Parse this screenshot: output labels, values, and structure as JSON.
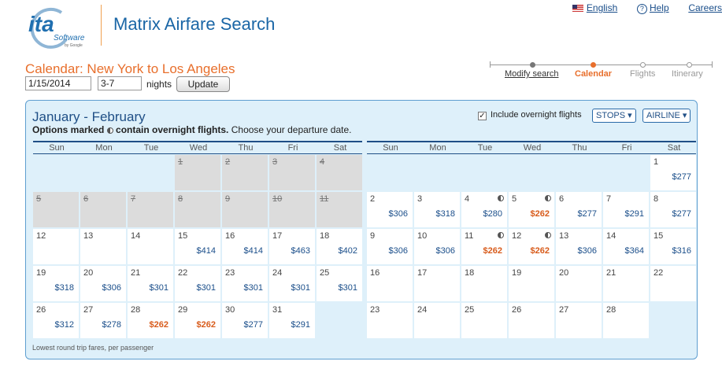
{
  "header": {
    "logo_text": "ita",
    "logo_sub": "Software",
    "logo_by": "by Google",
    "app_title": "Matrix Airfare Search",
    "links": [
      "English",
      "Help",
      "Careers"
    ]
  },
  "page_title": "Calendar: New York to Los Angeles",
  "form": {
    "date": "1/15/2014",
    "nights": "3-7",
    "nights_label": "nights",
    "update_label": "Update"
  },
  "steps": [
    "Modify search",
    "Calendar",
    "Flights",
    "Itinerary"
  ],
  "calendar": {
    "heading": "January - February",
    "sub_bold_1": "Options marked",
    "sub_bold_2": "contain overnight flights.",
    "sub_rest": "Choose your departure date.",
    "overnight_label": "Include overnight flights",
    "stops_label": "STOPS",
    "airline_label": "AIRLINE",
    "weekdays": [
      "Sun",
      "Mon",
      "Tue",
      "Wed",
      "Thu",
      "Fri",
      "Sat"
    ],
    "footnote": "Lowest round trip fares, per passenger",
    "colors": {
      "accent": "#e86f2c",
      "link": "#1a4e8a",
      "panel": "#def0fa",
      "border": "#5e9ed0"
    },
    "months": [
      {
        "name": "January",
        "weeks": [
          [
            null,
            null,
            null,
            {
              "d": "1",
              "past": true
            },
            {
              "d": "2",
              "past": true
            },
            {
              "d": "3",
              "past": true
            },
            {
              "d": "4",
              "past": true
            }
          ],
          [
            {
              "d": "5",
              "past": true
            },
            {
              "d": "6",
              "past": true
            },
            {
              "d": "7",
              "past": true
            },
            {
              "d": "8",
              "past": true
            },
            {
              "d": "9",
              "past": true
            },
            {
              "d": "10",
              "past": true
            },
            {
              "d": "11",
              "past": true
            }
          ],
          [
            {
              "d": "12"
            },
            {
              "d": "13"
            },
            {
              "d": "14"
            },
            {
              "d": "15",
              "p": "$414"
            },
            {
              "d": "16",
              "p": "$414"
            },
            {
              "d": "17",
              "p": "$463"
            },
            {
              "d": "18",
              "p": "$402"
            }
          ],
          [
            {
              "d": "19",
              "p": "$318"
            },
            {
              "d": "20",
              "p": "$306"
            },
            {
              "d": "21",
              "p": "$301"
            },
            {
              "d": "22",
              "p": "$301"
            },
            {
              "d": "23",
              "p": "$301"
            },
            {
              "d": "24",
              "p": "$301"
            },
            {
              "d": "25",
              "p": "$301"
            }
          ],
          [
            {
              "d": "26",
              "p": "$312"
            },
            {
              "d": "27",
              "p": "$278"
            },
            {
              "d": "28",
              "p": "$262",
              "low": true
            },
            {
              "d": "29",
              "p": "$262",
              "low": true
            },
            {
              "d": "30",
              "p": "$277"
            },
            {
              "d": "31",
              "p": "$291"
            },
            null
          ]
        ]
      },
      {
        "name": "February",
        "weeks": [
          [
            null,
            null,
            null,
            null,
            null,
            null,
            {
              "d": "1",
              "p": "$277"
            }
          ],
          [
            {
              "d": "2",
              "p": "$306"
            },
            {
              "d": "3",
              "p": "$318"
            },
            {
              "d": "4",
              "p": "$280",
              "on": true
            },
            {
              "d": "5",
              "p": "$262",
              "low": true,
              "on": true
            },
            {
              "d": "6",
              "p": "$277"
            },
            {
              "d": "7",
              "p": "$291"
            },
            {
              "d": "8",
              "p": "$277"
            }
          ],
          [
            {
              "d": "9",
              "p": "$306"
            },
            {
              "d": "10",
              "p": "$306"
            },
            {
              "d": "11",
              "p": "$262",
              "low": true,
              "on": true
            },
            {
              "d": "12",
              "p": "$262",
              "low": true,
              "on": true
            },
            {
              "d": "13",
              "p": "$306"
            },
            {
              "d": "14",
              "p": "$364"
            },
            {
              "d": "15",
              "p": "$316"
            }
          ],
          [
            {
              "d": "16"
            },
            {
              "d": "17"
            },
            {
              "d": "18"
            },
            {
              "d": "19"
            },
            {
              "d": "20"
            },
            {
              "d": "21"
            },
            {
              "d": "22"
            }
          ],
          [
            {
              "d": "23"
            },
            {
              "d": "24"
            },
            {
              "d": "25"
            },
            {
              "d": "26"
            },
            {
              "d": "27"
            },
            {
              "d": "28"
            },
            null
          ]
        ]
      }
    ]
  }
}
